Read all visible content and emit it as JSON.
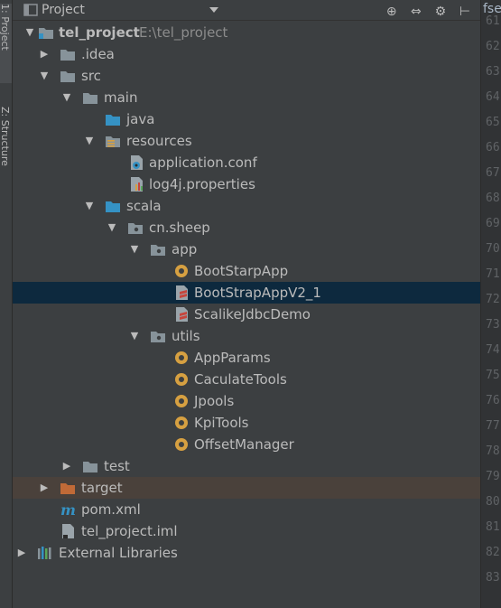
{
  "side_tabs": {
    "project": "1: Project",
    "structure": "Z: Structure"
  },
  "header": {
    "title": "Project",
    "tools": [
      "⊕",
      "⇔",
      "⚙",
      "⊢"
    ]
  },
  "tree": [
    {
      "label": "tel_project",
      "path": "E:\\tel_project",
      "bold": true,
      "expanded": true
    },
    {
      "label": ".idea",
      "expanded": false
    },
    {
      "label": "src",
      "expanded": true
    },
    {
      "label": "main",
      "expanded": true
    },
    {
      "label": "java"
    },
    {
      "label": "resources",
      "expanded": true
    },
    {
      "label": "application.conf"
    },
    {
      "label": "log4j.properties"
    },
    {
      "label": "scala",
      "expanded": true
    },
    {
      "label": "cn.sheep",
      "expanded": true
    },
    {
      "label": "app",
      "expanded": true
    },
    {
      "label": "BootStarpApp"
    },
    {
      "label": "BootStrapAppV2_1",
      "selected": true
    },
    {
      "label": "ScalikeJdbcDemo"
    },
    {
      "label": "utils",
      "expanded": true
    },
    {
      "label": "AppParams"
    },
    {
      "label": "CaculateTools"
    },
    {
      "label": "Jpools"
    },
    {
      "label": "KpiTools"
    },
    {
      "label": "OffsetManager"
    },
    {
      "label": "test",
      "expanded": false
    },
    {
      "label": "target",
      "expanded": false,
      "excluded": true
    },
    {
      "label": "pom.xml"
    },
    {
      "label": "tel_project.iml"
    },
    {
      "label": "External Libraries",
      "expanded": false
    }
  ],
  "editor": {
    "tab_fragment": "fse",
    "line_numbers": [
      "61",
      "62",
      "63",
      "64",
      "65",
      "66",
      "67",
      "68",
      "69",
      "70",
      "71",
      "72",
      "73",
      "74",
      "75",
      "76",
      "77",
      "78",
      "79",
      "80",
      "81",
      "82",
      "83"
    ]
  },
  "colors": {
    "selection": "#0d293e",
    "excluded": "#4a413b",
    "folder": "#87939a",
    "source": "#3592c4",
    "scala_obj": "#d6a041",
    "target": "#c16a37"
  }
}
